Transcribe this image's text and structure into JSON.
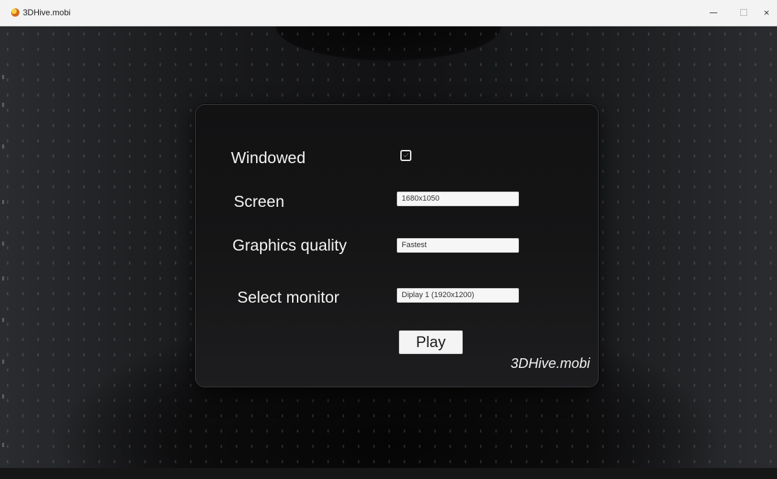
{
  "window": {
    "title": "3DHive.mobi",
    "controls": {
      "minimize": "minimize",
      "maximize": "maximize",
      "close": "×"
    }
  },
  "settings": {
    "windowed_label": "Windowed",
    "windowed_checked": true,
    "screen_label": "Screen",
    "screen_value": "1680x1050",
    "quality_label": "Graphics quality",
    "quality_value": "Fastest",
    "monitor_label": "Select monitor",
    "monitor_value": "Diplay 1 (1920x1200)",
    "play_label": "Play"
  },
  "branding": {
    "watermark": "3DHive.mobi"
  },
  "icons": {
    "app": "3dhive-app-icon",
    "minimize": "minimize-icon",
    "maximize": "maximize-icon",
    "close": "close-icon"
  }
}
